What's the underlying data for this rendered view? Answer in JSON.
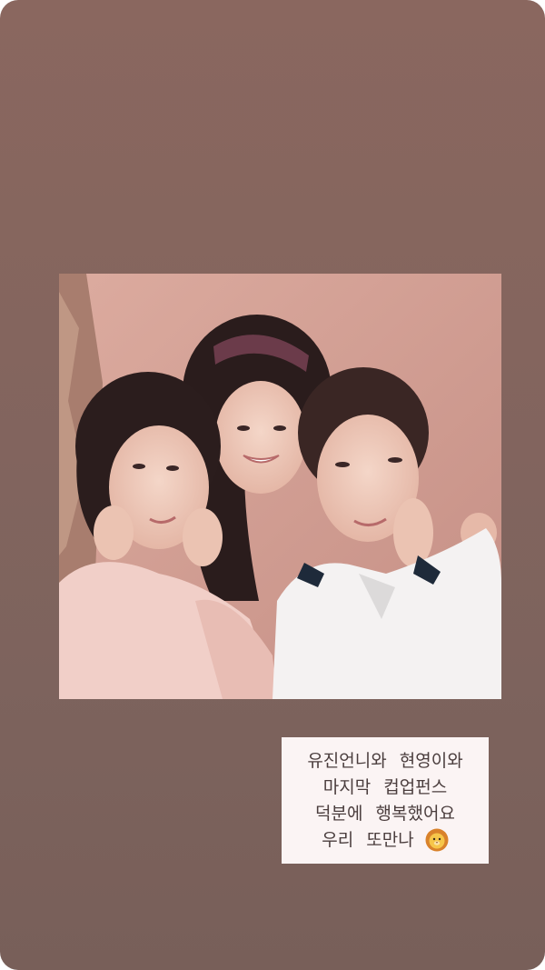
{
  "story": {
    "background_color": "#84655e",
    "caption": {
      "lines": [
        "유진언니와 현영이와",
        "마지막 컵업펀스",
        "덕분에 행복했어요",
        "우리 또만나"
      ],
      "sticker_icon": "lion-face-icon"
    }
  }
}
